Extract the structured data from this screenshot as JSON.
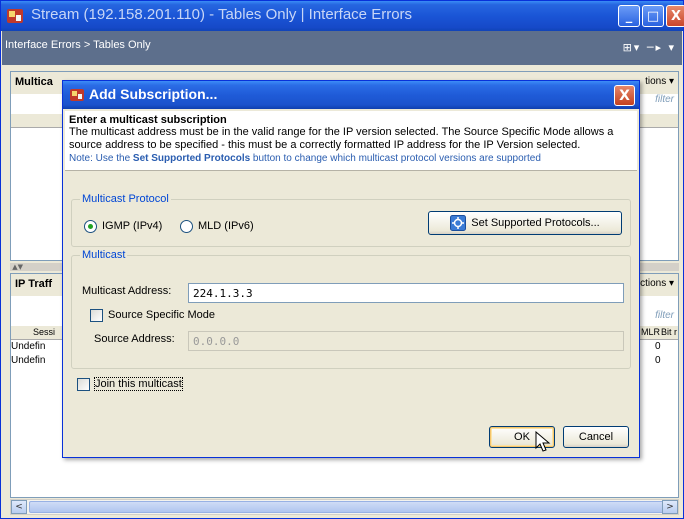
{
  "window": {
    "title": "Stream (192.158.201.110) - Tables Only | Interface Errors",
    "minimize": "_",
    "maximize": "□",
    "close": "X"
  },
  "breadcrumb": {
    "text": "Interface Errors > Tables Only",
    "tools": "⊞▾ ─▸ ▾"
  },
  "top_panel": {
    "title": "Multica",
    "actions": "tions ▾",
    "filter": "filter"
  },
  "bottom_panel": {
    "title": "IP Traff",
    "actions": "ctions ▾",
    "filter": "filter",
    "columns": [
      "Sessi",
      "MLR",
      "Bit r"
    ],
    "rows": [
      {
        "session": "Undefin",
        "mlr": "0"
      },
      {
        "session": "Undefin",
        "mlr": "0"
      }
    ]
  },
  "dialog": {
    "title": "Add Subscription...",
    "close": "X",
    "banner": {
      "title": "Enter a multicast subscription",
      "text": "The multicast address must be in the valid range for the IP version selected. The Source Specific Mode allows a source address to be specified - this must be a correctly formatted IP address for the IP Version selected.",
      "note_prefix": "Note: Use the ",
      "note_bold": "Set Supported Protocols",
      "note_suffix": " button to change which multicast protocol versions are supported"
    },
    "protocol_group": {
      "label": "Multicast Protocol",
      "igmp_label": "IGMP (IPv4)",
      "mld_label": "MLD (IPv6)",
      "selected": "IGMP (IPv4)",
      "set_protocols_button": "Set Supported Protocols..."
    },
    "multicast_group": {
      "label": "Multicast",
      "address_label": "Multicast Address:",
      "address_value": "224.1.3.3",
      "ssm_label": "Source Specific Mode",
      "ssm_checked": false,
      "source_label": "Source Address:",
      "source_placeholder": "0.0.0.0"
    },
    "join_label": "Join this multicast",
    "join_checked": false,
    "ok_button": "OK",
    "cancel_button": "Cancel"
  },
  "colors": {
    "titlebar_blue": "#1f5bd8",
    "dialog_bg": "#ece9d8",
    "group_label": "#0046d5",
    "note_blue": "#2a5db0",
    "breadcrumb_bg": "#5d6f8c"
  }
}
